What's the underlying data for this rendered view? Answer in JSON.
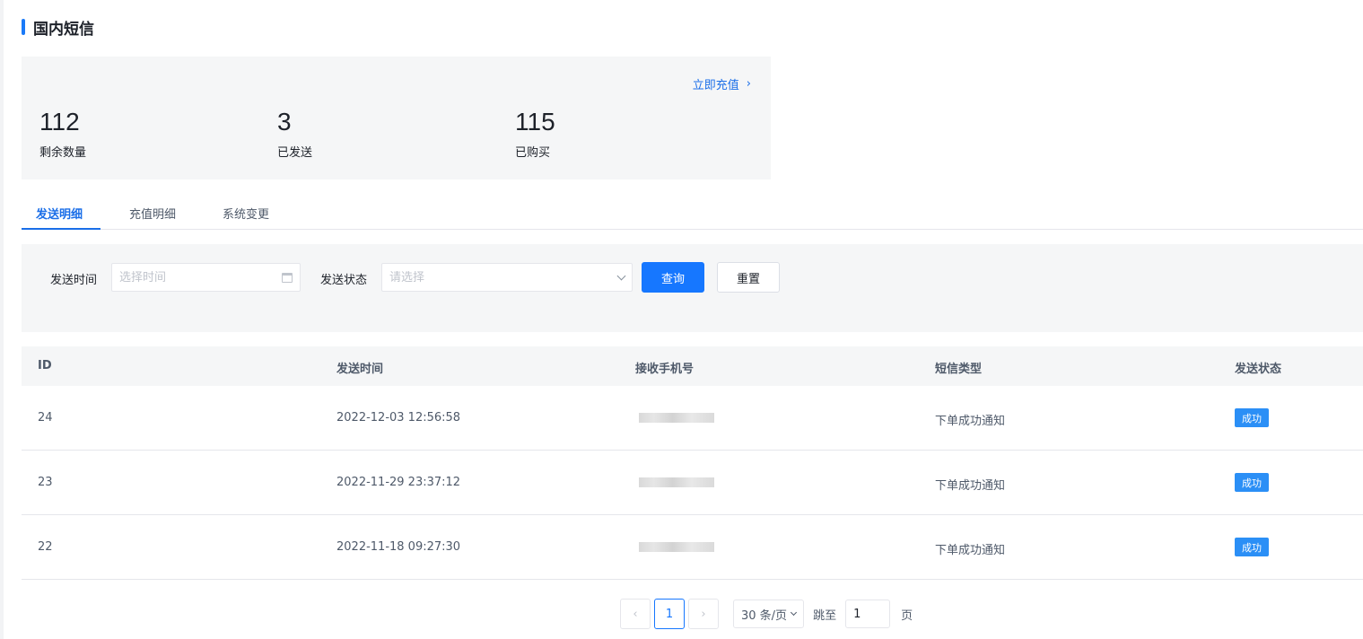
{
  "header": {
    "title": "国内短信"
  },
  "stats": {
    "recharge_link": "立即充值",
    "items": [
      {
        "value": "112",
        "label": "剩余数量"
      },
      {
        "value": "3",
        "label": "已发送"
      },
      {
        "value": "115",
        "label": "已购买"
      }
    ]
  },
  "tabs": [
    {
      "label": "发送明细",
      "active": true
    },
    {
      "label": "充值明细",
      "active": false
    },
    {
      "label": "系统变更",
      "active": false
    }
  ],
  "filters": {
    "send_time_label": "发送时间",
    "send_time_placeholder": "选择时间",
    "status_label": "发送状态",
    "status_placeholder": "请选择",
    "query_button": "查询",
    "reset_button": "重置"
  },
  "table": {
    "columns": [
      "ID",
      "发送时间",
      "接收手机号",
      "短信类型",
      "发送状态"
    ],
    "rows": [
      {
        "id": "24",
        "time": "2022-12-03 12:56:58",
        "type": "下单成功通知",
        "status": "成功"
      },
      {
        "id": "23",
        "time": "2022-11-29 23:37:12",
        "type": "下单成功通知",
        "status": "成功"
      },
      {
        "id": "22",
        "time": "2022-11-18 09:27:30",
        "type": "下单成功通知",
        "status": "成功"
      }
    ]
  },
  "pagination": {
    "current_page": "1",
    "page_size": "30 条/页",
    "jump_label": "跳至",
    "jump_value": "1",
    "page_unit": "页"
  },
  "colors": {
    "accent": "#1677ff",
    "success_badge": "#2b8ff6",
    "panel_bg": "#f5f6f7"
  }
}
